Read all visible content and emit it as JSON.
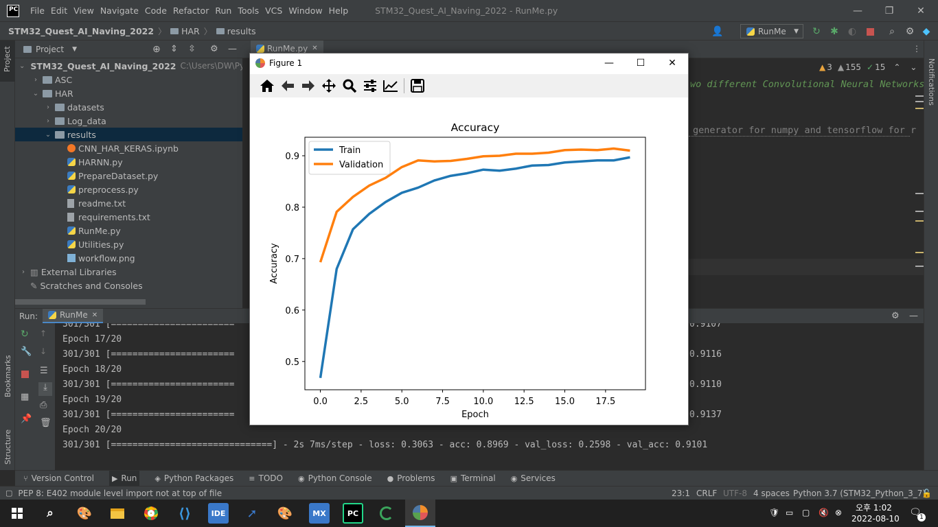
{
  "app": {
    "logo_text": "PC",
    "menus": [
      "File",
      "Edit",
      "View",
      "Navigate",
      "Code",
      "Refactor",
      "Run",
      "Tools",
      "VCS",
      "Window",
      "Help"
    ],
    "window_title": "STM32_Quest_AI_Naving_2022 - RunMe.py"
  },
  "breadcrumb": [
    "STM32_Quest_AI_Naving_2022",
    "HAR",
    "results"
  ],
  "run_config": {
    "label": "RunMe"
  },
  "left_strip": {
    "project": "Project",
    "bookmarks": "Bookmarks",
    "structure": "Structure"
  },
  "right_strip": {
    "notifications": "Notifications"
  },
  "project": {
    "header": "Project",
    "root": {
      "label": "STM32_Quest_AI_Naving_2022",
      "hint": "C:\\Users\\DW\\PycI"
    },
    "tree": [
      {
        "label": "ASC",
        "kind": "folder",
        "indent": 1,
        "arrow": "›"
      },
      {
        "label": "HAR",
        "kind": "folder",
        "indent": 1,
        "arrow": "⌄"
      },
      {
        "label": "datasets",
        "kind": "folder",
        "indent": 2,
        "arrow": "›"
      },
      {
        "label": "Log_data",
        "kind": "folder",
        "indent": 2,
        "arrow": "›"
      },
      {
        "label": "results",
        "kind": "folder",
        "indent": 2,
        "arrow": "⌄",
        "selected": true
      },
      {
        "label": "CNN_HAR_KERAS.ipynb",
        "kind": "nb",
        "indent": 3
      },
      {
        "label": "HARNN.py",
        "kind": "py",
        "indent": 3
      },
      {
        "label": "PrepareDataset.py",
        "kind": "py",
        "indent": 3
      },
      {
        "label": "preprocess.py",
        "kind": "py",
        "indent": 3
      },
      {
        "label": "readme.txt",
        "kind": "file",
        "indent": 3
      },
      {
        "label": "requirements.txt",
        "kind": "file",
        "indent": 3
      },
      {
        "label": "RunMe.py",
        "kind": "py",
        "indent": 3
      },
      {
        "label": "Utilities.py",
        "kind": "py",
        "indent": 3
      },
      {
        "label": "workflow.png",
        "kind": "img",
        "indent": 3
      }
    ],
    "external_libraries": "External Libraries",
    "scratches": "Scratches and Consoles"
  },
  "editor": {
    "tab": "RunMe.py",
    "code_line_1": "wo different Convolutional Neural Networks",
    "code_line_2": "generator for numpy and tensorflow for r",
    "inspections": {
      "warnings": "3",
      "weak_warnings": "155",
      "typos": "15"
    }
  },
  "run_panel": {
    "label": "Run:",
    "tab": "RunMe",
    "lines": [
      {
        "left": "301/301 [=======================",
        "right": "0.9107"
      },
      {
        "left": "Epoch 17/20",
        "right": ""
      },
      {
        "left": "301/301 [=======================",
        "right": "0.9116"
      },
      {
        "left": "Epoch 18/20",
        "right": ""
      },
      {
        "left": "301/301 [=======================",
        "right": "0.9110"
      },
      {
        "left": "Epoch 19/20",
        "right": ""
      },
      {
        "left": "301/301 [=======================",
        "right": "0.9137"
      },
      {
        "left": "Epoch 20/20",
        "right": ""
      },
      {
        "left": "301/301 [==============================] - 2s 7ms/step - loss: 0.3063 - acc: 0.8969 - val_loss: 0.2598 - val_acc: 0.9101",
        "right": ""
      }
    ]
  },
  "tool_tabs": [
    "Version Control",
    "Run",
    "Python Packages",
    "TODO",
    "Python Console",
    "Problems",
    "Terminal",
    "Services"
  ],
  "status": {
    "message": "PEP 8: E402 module level import not at top of file",
    "position": "23:1",
    "line_sep": "CRLF",
    "encoding": "UTF-8",
    "indent": "4 spaces",
    "interpreter": "Python 3.7 (STM32_Python_3_7)"
  },
  "taskbar": {
    "ide_label": "IDE",
    "mx_label": "MX",
    "pc_label": "PC",
    "time": "오후 1:02",
    "date": "2022-08-10",
    "notif_count": "1"
  },
  "figure": {
    "title": "Figure 1",
    "chart_data": {
      "type": "line",
      "title": "Accuracy",
      "xlabel": "Epoch",
      "ylabel": "Accuracy",
      "xlim": [
        -0.95,
        19.95
      ],
      "ylim": [
        0.445,
        0.936
      ],
      "xticks": [
        "0.0",
        "2.5",
        "5.0",
        "7.5",
        "10.0",
        "12.5",
        "15.0",
        "17.5"
      ],
      "xtick_values": [
        0,
        2.5,
        5,
        7.5,
        10,
        12.5,
        15,
        17.5
      ],
      "yticks": [
        "0.5",
        "0.6",
        "0.7",
        "0.8",
        "0.9"
      ],
      "ytick_values": [
        0.5,
        0.6,
        0.7,
        0.8,
        0.9
      ],
      "legend_position": "top-left",
      "x": [
        0,
        1,
        2,
        3,
        4,
        5,
        6,
        7,
        8,
        9,
        10,
        11,
        12,
        13,
        14,
        15,
        16,
        17,
        18,
        19
      ],
      "series": [
        {
          "name": "Train",
          "color": "#1f77b4",
          "values": [
            0.468,
            0.68,
            0.757,
            0.787,
            0.81,
            0.828,
            0.838,
            0.852,
            0.861,
            0.866,
            0.873,
            0.871,
            0.875,
            0.881,
            0.882,
            0.887,
            0.889,
            0.891,
            0.891,
            0.897
          ]
        },
        {
          "name": "Validation",
          "color": "#ff7f0e",
          "values": [
            0.693,
            0.791,
            0.82,
            0.842,
            0.857,
            0.878,
            0.891,
            0.889,
            0.89,
            0.894,
            0.899,
            0.9,
            0.904,
            0.904,
            0.906,
            0.911,
            0.912,
            0.911,
            0.914,
            0.91
          ]
        }
      ]
    }
  }
}
